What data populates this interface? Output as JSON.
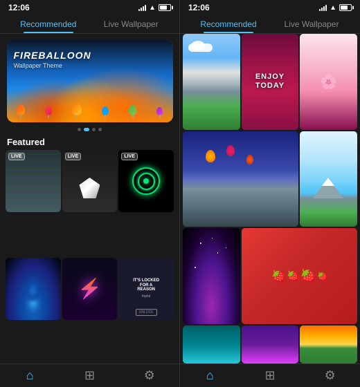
{
  "left_phone": {
    "status_time": "12:06",
    "tabs": [
      {
        "id": "recommended",
        "label": "Recommended",
        "active": true
      },
      {
        "id": "live",
        "label": "Live Wallpaper",
        "active": false
      }
    ],
    "hero": {
      "title": "FIREBALLOON",
      "subtitle": "Wallpaper Theme"
    },
    "dots": [
      0,
      1,
      2,
      3
    ],
    "active_dot": 1,
    "section_title": "Featured",
    "featured_items": [
      {
        "id": 1,
        "live": true,
        "type": "dollars"
      },
      {
        "id": 2,
        "live": true,
        "type": "diamond"
      },
      {
        "id": 3,
        "live": true,
        "type": "target"
      },
      {
        "id": 4,
        "live": false,
        "type": "bluefire"
      },
      {
        "id": 5,
        "live": false,
        "type": "lightning"
      },
      {
        "id": 6,
        "live": false,
        "type": "locked"
      }
    ],
    "nav": {
      "items": [
        {
          "id": "home",
          "icon": "⌂",
          "active": true
        },
        {
          "id": "grid",
          "icon": "⊞",
          "active": false
        },
        {
          "id": "settings",
          "icon": "⚙",
          "active": false
        }
      ]
    }
  },
  "right_phone": {
    "status_time": "12:06",
    "tabs": [
      {
        "id": "recommended",
        "label": "Recommended",
        "active": true
      },
      {
        "id": "live",
        "label": "Live Wallpaper",
        "active": false
      }
    ],
    "grid_items": [
      {
        "id": 1,
        "type": "mountain"
      },
      {
        "id": 2,
        "type": "enjoy"
      },
      {
        "id": 3,
        "type": "cherry"
      },
      {
        "id": 4,
        "type": "balloons"
      },
      {
        "id": 5,
        "type": "fuji"
      },
      {
        "id": 6,
        "type": "strawberry"
      },
      {
        "id": 7,
        "type": "space"
      },
      {
        "id": 8,
        "type": "green"
      }
    ],
    "nav": {
      "items": [
        {
          "id": "home",
          "icon": "⌂",
          "active": true
        },
        {
          "id": "grid",
          "icon": "⊞",
          "active": false
        },
        {
          "id": "settings",
          "icon": "⚙",
          "active": false
        }
      ]
    }
  },
  "colors": {
    "accent": "#4fc3f7",
    "tab_active": "#4fc3f7",
    "tab_inactive": "#888888",
    "bg": "#1a1a1a",
    "live_badge_border": "rgba(255,255,255,0.5)"
  },
  "labels": {
    "live": "LIVE",
    "enjoy_line1": "ENJOY",
    "enjoy_line2": "TODAY",
    "locked_main": "IT'S LOCKED\nFOR A\nREASON",
    "locked_sub": "fnpful",
    "locked_btn": "UNLOCK"
  }
}
